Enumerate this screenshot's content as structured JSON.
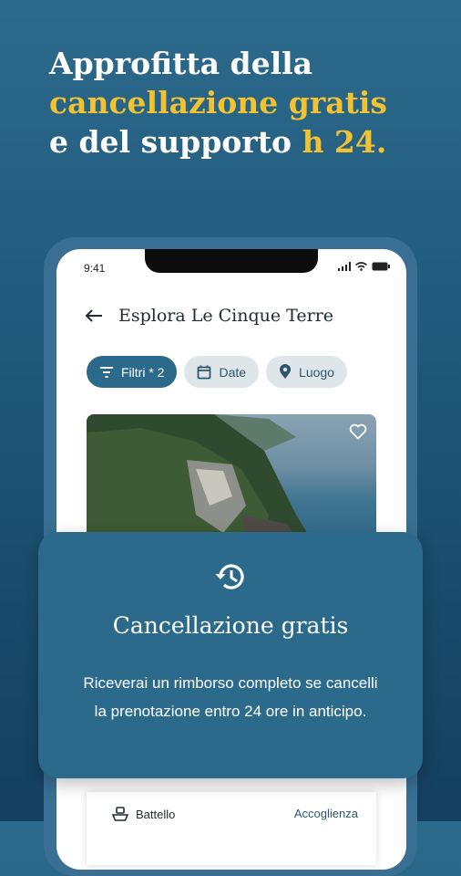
{
  "headline": {
    "line1": "Approfitta della",
    "line2": "cancellazione gratis",
    "line3_prefix": "e del supporto ",
    "line3_highlight": "h 24."
  },
  "colors": {
    "highlight": "#f2c230",
    "primary": "#2c6a8c"
  },
  "phone": {
    "status_time": "9:41",
    "header": {
      "back_icon": "arrow-left-icon",
      "title": "Esplora Le Cinque Terre"
    },
    "chips": [
      {
        "label": "Filtri * 2",
        "icon": "filter-icon",
        "active": true
      },
      {
        "label": "Date",
        "icon": "calendar-icon",
        "active": false
      },
      {
        "label": "Luogo",
        "icon": "location-pin-icon",
        "active": false
      }
    ],
    "card_bottom": {
      "left_label": "Battello",
      "right_label": "Accoglienza"
    }
  },
  "overlay": {
    "icon": "history-icon",
    "title": "Cancellazione gratis",
    "text": "Riceverai un rimborso completo se cancelli la prenotazione entro 24 ore in anticipo."
  }
}
